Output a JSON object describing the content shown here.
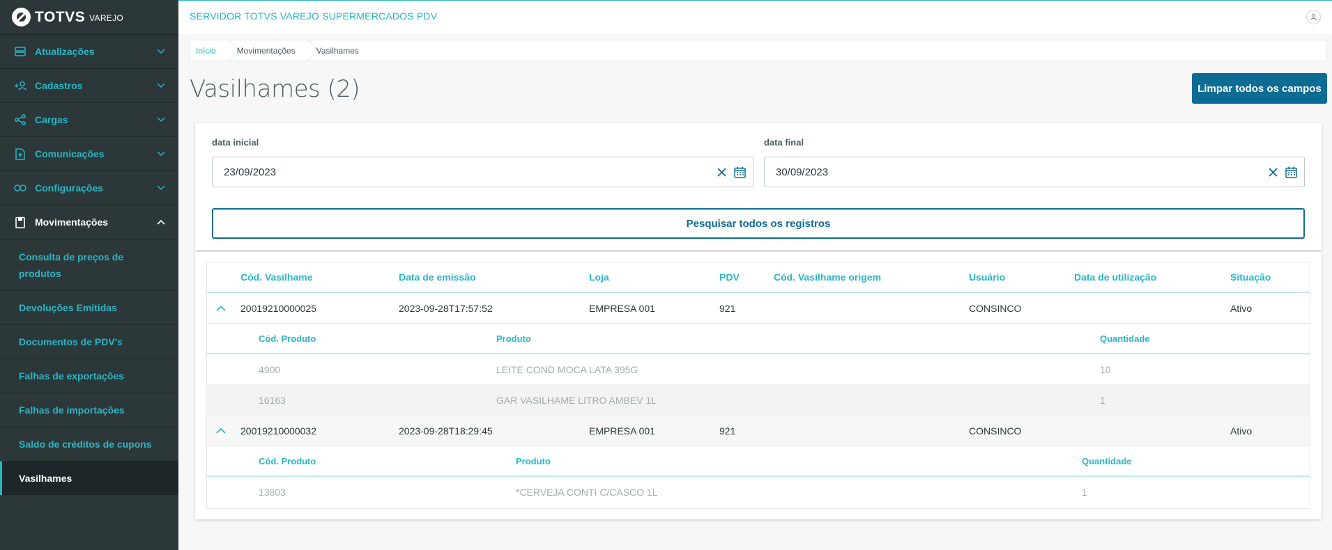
{
  "brand": {
    "name": "TOTVS",
    "sub": "VAREJO"
  },
  "sidebar": {
    "items": [
      {
        "label": "Atualizações",
        "icon": "server-icon"
      },
      {
        "label": "Cadastros",
        "icon": "add-user-icon"
      },
      {
        "label": "Cargas",
        "icon": "share-icon"
      },
      {
        "label": "Comunicações",
        "icon": "document-upload-icon"
      },
      {
        "label": "Configurações",
        "icon": "link-icon"
      },
      {
        "label": "Movimentações",
        "icon": "clipboard-icon"
      }
    ],
    "sub_items": [
      {
        "label": "Consulta de preços de produtos"
      },
      {
        "label": "Devoluções Emitidas"
      },
      {
        "label": "Documentos de PDV's"
      },
      {
        "label": "Falhas de exportações"
      },
      {
        "label": "Falhas de importações"
      },
      {
        "label": "Saldo de créditos de cupons"
      },
      {
        "label": "Vasilhames"
      }
    ]
  },
  "header": {
    "server_title": "SERVIDOR TOTVS VAREJO SUPERMERCADOS PDV"
  },
  "breadcrumb": [
    "Início",
    "Movimentações",
    "Vasilhames"
  ],
  "page": {
    "title": "Vasilhames (2)",
    "clear_label": "Limpar todos os campos"
  },
  "filters": {
    "start_label": "data inicial",
    "start_value": "23/09/2023",
    "end_label": "data final",
    "end_value": "30/09/2023",
    "search_label": "Pesquisar todos os registros"
  },
  "table": {
    "columns": [
      "Cód. Vasilhame",
      "Data de emissão",
      "Loja",
      "PDV",
      "Cód. Vasilhame origem",
      "Usuário",
      "Data de utilização",
      "Situação"
    ],
    "sub_columns": [
      "Cód. Produto",
      "Produto",
      "Quantidade"
    ],
    "rows": [
      {
        "cod": "20019210000025",
        "data": "2023-09-28T17:57:52",
        "loja": "EMPRESA 001",
        "pdv": "921",
        "origem": "",
        "usuario": "CONSINCO",
        "utilizacao": "",
        "situacao": "Ativo",
        "items": [
          {
            "cod": "4900",
            "produto": "LEITE COND MOCA LATA 395G",
            "qtd": "10"
          },
          {
            "cod": "16163",
            "produto": "GAR VASILHAME LITRO AMBEV 1L",
            "qtd": "1"
          }
        ]
      },
      {
        "cod": "20019210000032",
        "data": "2023-09-28T18:29:45",
        "loja": "EMPRESA 001",
        "pdv": "921",
        "origem": "",
        "usuario": "CONSINCO",
        "utilizacao": "",
        "situacao": "Ativo",
        "items": [
          {
            "cod": "13803",
            "produto": "*CERVEJA CONTI C/CASCO 1L",
            "qtd": "1"
          }
        ]
      }
    ]
  },
  "colors": {
    "sidebar_bg": "#2c3739",
    "accent": "#29b6c5",
    "primary": "#0c6c94"
  }
}
